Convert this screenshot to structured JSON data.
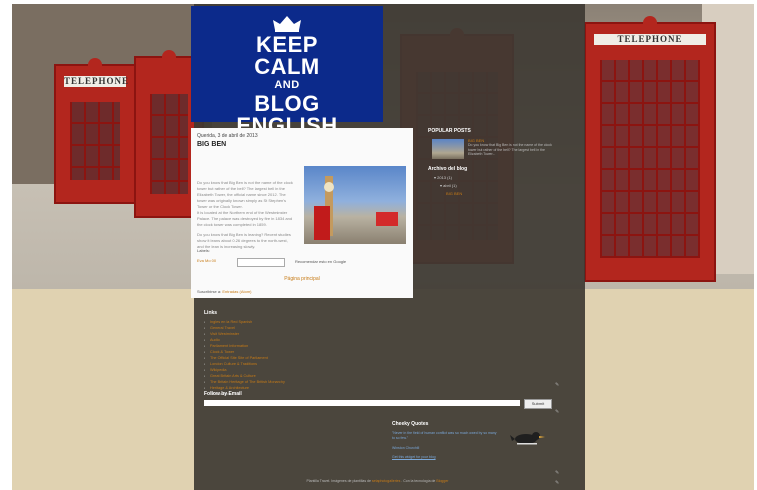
{
  "header": {
    "line1": "KEEP",
    "line2": "CALM",
    "line3": "AND",
    "line4": "BLOG",
    "line5": "ENGLISH"
  },
  "backdrop": {
    "sign_left": "TELEPHONE",
    "sign_right": "TELEPHONE"
  },
  "post": {
    "date": "Querida, 3 de abril de 2013",
    "title": "BIG BEN",
    "paragraphs": [
      "Do you know that Big Ben is not the name of the clock tower but rather of the bell? The largest bell in the Elizabeth Tower, the official name since 2012. The tower was originally known simply as St Stephen's Tower or the Clock Tower.",
      "It is located at the Northern end of the Westminster Palace. The palace was destroyed by fire in 1834 and the clock tower was completed in 1859.",
      "Do you know that Big Ben is leaning? Recent studies show it leans about 0.26 degrees to the north-west, and the lean is increasing slowly."
    ],
    "labels": "Labels:",
    "author": "Eva Mo 00",
    "recommend": "Recomendar esto en Google",
    "prev": "Página principal",
    "subscribe_prefix": "Suscribirse a:",
    "subscribe_link": "Entradas (Atom)"
  },
  "popular": {
    "title": "POPULAR POSTS",
    "post_title": "BIG BEN",
    "post_excerpt": "Do you know that Big Ben is not the name of the clock tower but rather of the bell? The largest bell in the Elizabeth Tower..."
  },
  "archive": {
    "title": "Archivo del blog",
    "year": "▾ 2013 (1)",
    "month": "▾ abril (1)",
    "post": "BIG BEN"
  },
  "links": {
    "title": "Links",
    "items": [
      "Ingles en la Red Spanish",
      "General Travel",
      "Visit Westminster",
      "Audio",
      "Parliament Information",
      "Clock & Tower",
      "The Official Site Site of Parliament",
      "London Culture & Traditions",
      "Wikipedia",
      "Great Britain Arts & Culture",
      "The Britain Heritage of The British Monarchy",
      "Heritage & Architecture",
      "TFL London"
    ]
  },
  "follow": {
    "title": "Follow by Email",
    "button": "Submit"
  },
  "quotes": {
    "title": "Cheeky Quotes",
    "text": "\"Never in the field of human conflict was so much owed by so many to so few.\"",
    "author": "Winston Churchill",
    "link": "Get this widget for your blog"
  },
  "footer": {
    "prefix": "Plantilla Travel. Imágenes de plantillas de",
    "link1": "setaphotogalleries",
    "middle": ". Con la tecnología de",
    "link2": "Blogger"
  },
  "colors": {
    "accent": "#c77b16",
    "header_blue": "#0c2a8b",
    "dark_panel": "#3e3933",
    "booth_red": "#b3261e"
  }
}
